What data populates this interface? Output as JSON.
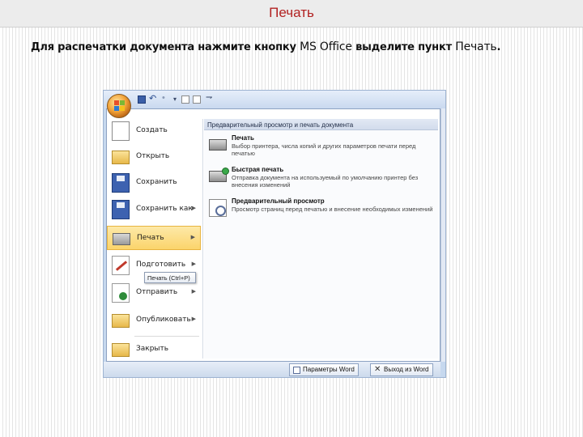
{
  "slide": {
    "title": "Печать",
    "subtitle_parts": [
      "Для распечатки документа нажмите кнопку ",
      "MS Office",
      " выделите пункт ",
      "Печать",
      "."
    ]
  },
  "screenshot": {
    "quick_access": [
      "save-icon",
      "undo-icon",
      "redo-icon",
      "new-doc-icon",
      "open-icon"
    ],
    "menu_left": [
      {
        "label": "Создать",
        "icon": "new-doc-icon"
      },
      {
        "label": "Открыть",
        "icon": "folder-icon"
      },
      {
        "label": "Сохранить",
        "icon": "save-icon"
      },
      {
        "label": "Сохранить как",
        "icon": "save-as-icon"
      },
      {
        "label": "Печать",
        "icon": "printer-icon"
      },
      {
        "label": "Подготовить",
        "icon": "prepare-icon"
      },
      {
        "label": "Отправить",
        "icon": "send-icon"
      },
      {
        "label": "Опубликовать",
        "icon": "publish-icon"
      },
      {
        "label": "Закрыть",
        "icon": "close-folder-icon"
      }
    ],
    "tooltip": "Печать (Ctrl+P)",
    "right_panel": {
      "header": "Предварительный просмотр и печать документа",
      "options": [
        {
          "title": "Печать",
          "desc": "Выбор принтера, числа копий и других параметров печати перед печатью"
        },
        {
          "title": "Быстрая печать",
          "desc": "Отправка документа на используемый по умолчанию принтер без внесения изменений"
        },
        {
          "title": "Предварительный просмотр",
          "desc": "Просмотр страниц перед печатью и внесение необходимых изменений"
        }
      ]
    },
    "bottom_buttons": [
      "Параметры Word",
      "Выход из Word"
    ]
  }
}
